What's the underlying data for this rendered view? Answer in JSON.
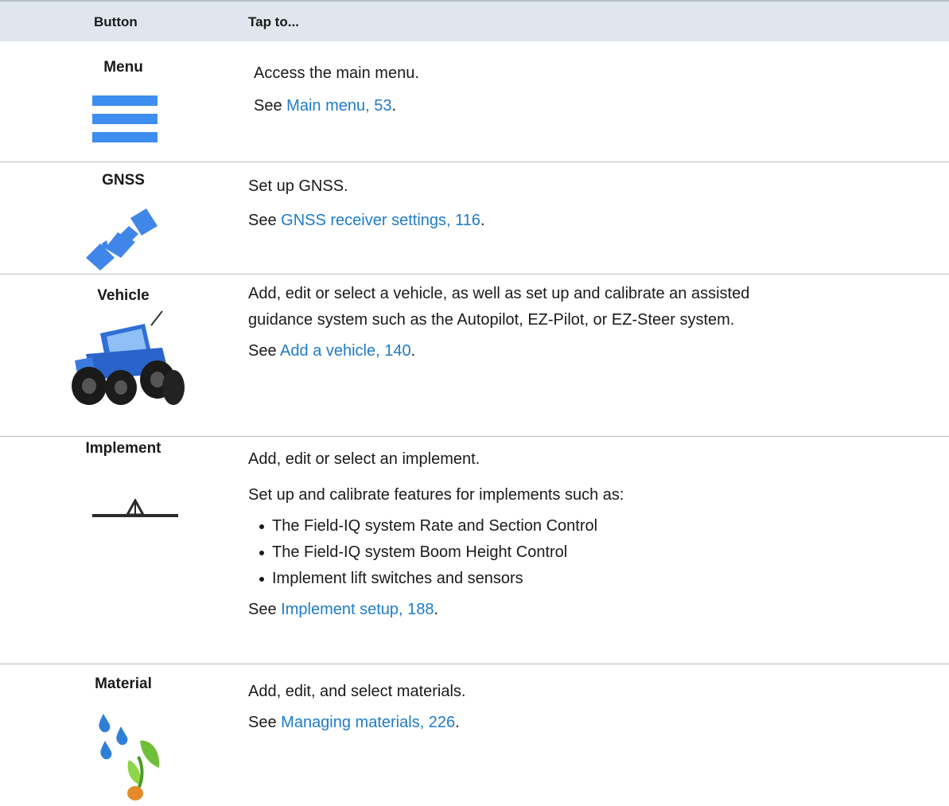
{
  "header": {
    "button_col": "Button",
    "tap_col": "Tap to..."
  },
  "rows": {
    "menu": {
      "name": "Menu",
      "icon": "menu-icon",
      "desc": "Access the main menu.",
      "see": "See ",
      "link": "Main menu, 53",
      "end": "."
    },
    "gnss": {
      "name": "GNSS",
      "icon": "satellite-icon",
      "desc": "Set up GNSS.",
      "see": "See ",
      "link": "GNSS receiver settings, 116",
      "end": "."
    },
    "vehicle": {
      "name": "Vehicle",
      "icon": "tractor-icon",
      "desc1": "Add, edit or select a vehicle, as well as set up and calibrate an assisted",
      "desc2": "guidance system such as the Autopilot, EZ-Pilot, or EZ-Steer system.",
      "see": "See ",
      "link": "Add a vehicle, 140",
      "end": "."
    },
    "implement": {
      "name": "Implement",
      "icon": "implement-icon",
      "desc1": "Add, edit or select an implement.",
      "desc2": "Set up and calibrate features for implements such as:",
      "bullets": [
        "The Field-IQ system Rate and Section Control",
        "The Field-IQ system Boom Height Control",
        "Implement lift switches and sensors"
      ],
      "see": "See ",
      "link": "Implement setup, 188",
      "end": "."
    },
    "material": {
      "name": "Material",
      "icon": "material-icon",
      "desc": "Add, edit, and select materials.",
      "see": "See ",
      "link": "Managing materials, 226",
      "end": "."
    }
  },
  "colors": {
    "link": "#1e7bc8",
    "header_bg": "#dfe6ee",
    "menu_icon": "#3d8ef0"
  }
}
